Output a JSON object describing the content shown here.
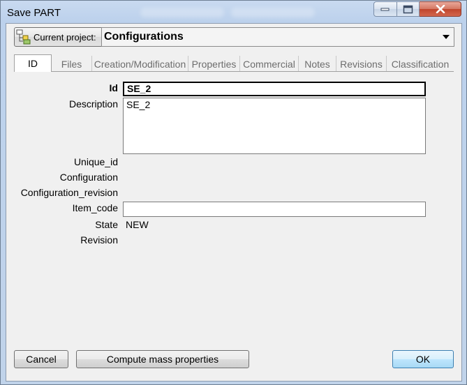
{
  "window": {
    "title": "Save  PART",
    "controls": [
      "minimize-icon",
      "maximize-icon",
      "close-icon"
    ]
  },
  "project": {
    "button_label": "Current project:",
    "button_icon": "project-tree-icon",
    "selected": "Configurations"
  },
  "tabs": [
    {
      "label": "ID",
      "active": true
    },
    {
      "label": "Files"
    },
    {
      "label": "Creation/Modification"
    },
    {
      "label": "Properties"
    },
    {
      "label": "Commercial"
    },
    {
      "label": "Notes"
    },
    {
      "label": "Revisions"
    },
    {
      "label": "Classification"
    }
  ],
  "form": {
    "id": {
      "label": "Id",
      "value": "SE_2"
    },
    "description": {
      "label": "Description",
      "value": "SE_2"
    },
    "unique_id": {
      "label": "Unique_id"
    },
    "configuration": {
      "label": "Configuration"
    },
    "configuration_revision": {
      "label": "Configuration_revision"
    },
    "item_code": {
      "label": "Item_code",
      "value": ""
    },
    "state": {
      "label": "State",
      "value": "NEW"
    },
    "revision": {
      "label": "Revision"
    }
  },
  "buttons": {
    "cancel": "Cancel",
    "compute": "Compute mass properties",
    "ok": "OK"
  },
  "colors": {
    "frame": "#bcd1ec",
    "close_button": "#c0452d",
    "ok_button": "#bee6fd"
  }
}
